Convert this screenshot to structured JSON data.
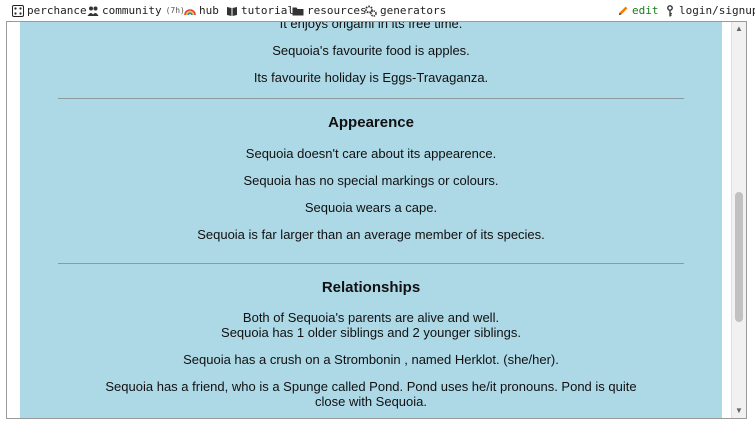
{
  "topbar": {
    "perchance": "perchance",
    "community": "community",
    "community_badge": "(7h)",
    "hub": "hub",
    "tutorial": "tutorial",
    "resources": "resources",
    "generators": "generators",
    "edit": "edit",
    "login": "login/signup"
  },
  "main": {
    "hobby_line": "It enjoys origami in its free time.",
    "food_line": "Sequoia's favourite food is apples.",
    "holiday_line": "Its favourite holiday is Eggs-Travaganza.",
    "appearance": {
      "heading": "Appearence",
      "line1": "Sequoia doesn't care about its appearence.",
      "line2": "Sequoia has no special markings or colours.",
      "line3": "Sequoia wears a cape.",
      "line4": "Sequoia is far larger than an average member of its species."
    },
    "relationships": {
      "heading": "Relationships",
      "parents": "Both of Sequoia's parents are alive and well.",
      "siblings": "Sequoia has 1 older siblings and 2 younger siblings.",
      "crush": "Sequoia has a crush on a Strombonin , named Herklot. (she/her).",
      "friend1": "Sequoia has a friend, who is a Spunge called Pond. Pond uses he/it pronouns. Pond is quite",
      "friend2": "close with Sequoia."
    }
  },
  "colors": {
    "content_bg": "#add8e6",
    "edit_green": "#1a7a1a"
  }
}
